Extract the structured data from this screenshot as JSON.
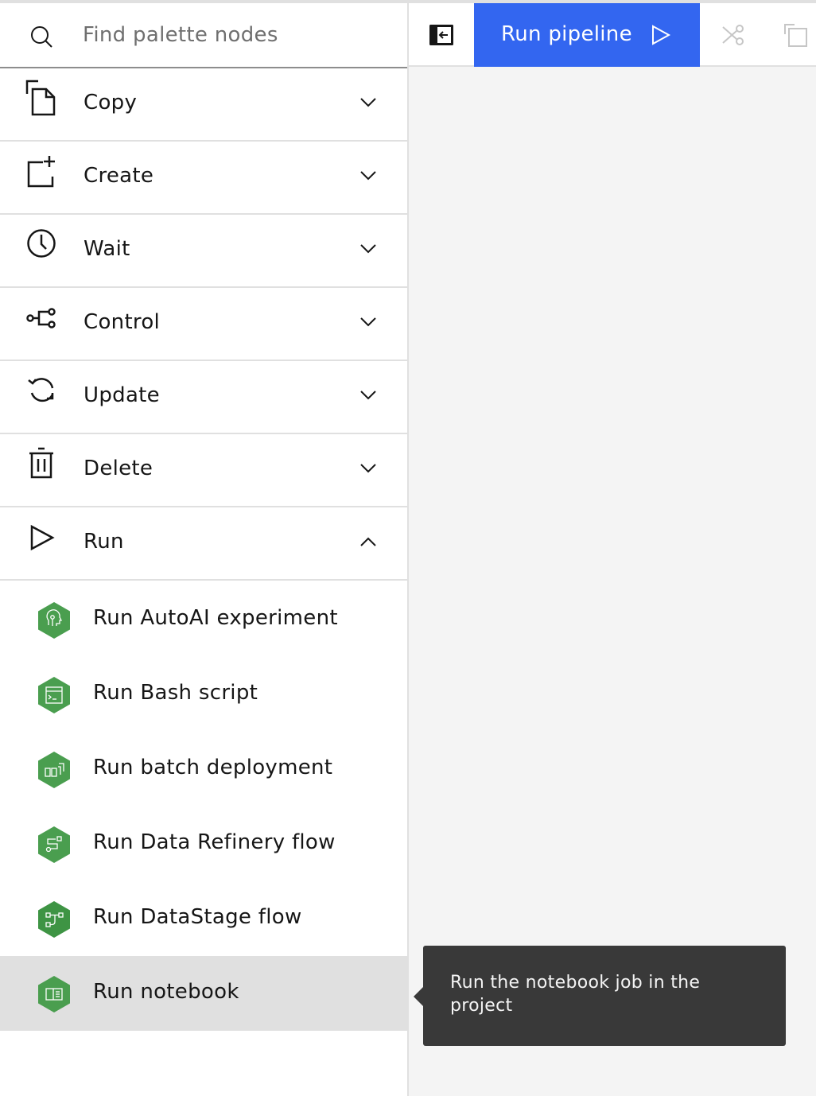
{
  "search": {
    "placeholder": "Find palette nodes",
    "value": ""
  },
  "categories": [
    {
      "label": "Copy",
      "icon": "copy-icon",
      "expanded": false
    },
    {
      "label": "Create",
      "icon": "create-icon",
      "expanded": false
    },
    {
      "label": "Wait",
      "icon": "clock-icon",
      "expanded": false
    },
    {
      "label": "Control",
      "icon": "flow-icon",
      "expanded": false
    },
    {
      "label": "Update",
      "icon": "refresh-icon",
      "expanded": false
    },
    {
      "label": "Delete",
      "icon": "trash-icon",
      "expanded": false
    },
    {
      "label": "Run",
      "icon": "play-icon",
      "expanded": true
    }
  ],
  "run_nodes": [
    {
      "label": "Run AutoAI experiment",
      "icon": "autoai-icon"
    },
    {
      "label": "Run Bash script",
      "icon": "terminal-icon"
    },
    {
      "label": "Run batch deployment",
      "icon": "batch-deployment-icon"
    },
    {
      "label": "Run Data Refinery flow",
      "icon": "data-refinery-icon"
    },
    {
      "label": "Run DataStage flow",
      "icon": "datastage-icon"
    },
    {
      "label": "Run notebook",
      "icon": "notebook-icon",
      "selected": true
    }
  ],
  "toolbar": {
    "run_pipeline_label": "Run pipeline",
    "toggle_palette_icon": "close-palette-icon",
    "cut_icon": "scissors-icon",
    "copy_icon": "copy-icon"
  },
  "tooltip": {
    "text": "Run the notebook job in the project"
  },
  "colors": {
    "primary": "#3366f0",
    "node_green": "#4a9e4f",
    "tooltip_bg": "#393939",
    "selected_bg": "#e0e0e0"
  }
}
